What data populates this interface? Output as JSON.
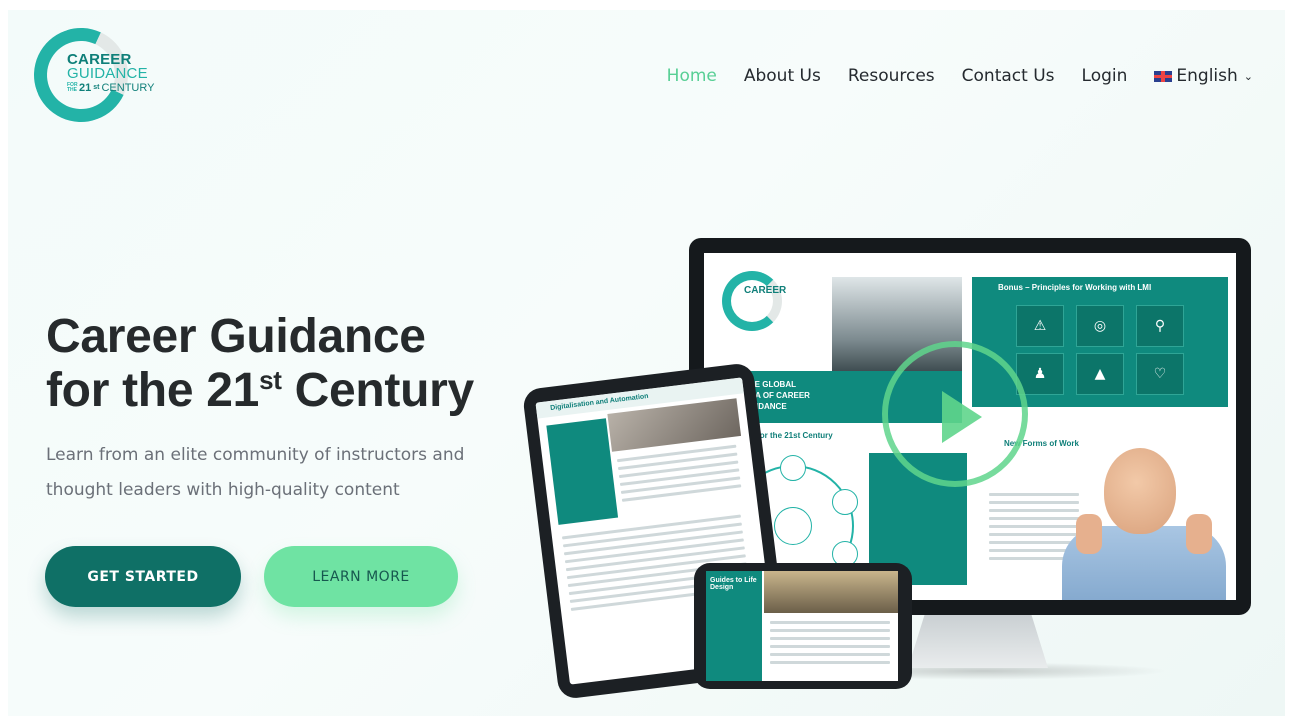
{
  "logo": {
    "line1": "CAREER",
    "line2": "GUIDANCE",
    "line3_prefix": "FOR THE",
    "line3_num": "21",
    "line3_sup": "st",
    "line3_word": "CENTURY"
  },
  "nav": {
    "items": [
      {
        "label": "Home",
        "active": true
      },
      {
        "label": "About Us",
        "active": false
      },
      {
        "label": "Resources",
        "active": false
      },
      {
        "label": "Contact Us",
        "active": false
      },
      {
        "label": "Login",
        "active": false
      }
    ],
    "language": "English"
  },
  "hero": {
    "title_line1": "Career Guidance",
    "title_line2_pre": "for the 21",
    "title_line2_sup": "st",
    "title_line2_post": " Century",
    "subtitle": "Learn from an elite community of instructors and thought leaders with high-quality content",
    "cta_primary": "GET STARTED",
    "cta_secondary": "LEARN MORE"
  },
  "mockup": {
    "screen_heading_skills": "Skills for the 21st Century",
    "screen_heading_bonus": "Bonus – Principles for Working with LMI",
    "screen_heading_work": "New Forms of Work",
    "screen_band": "THE GLOBAL ERA OF CAREER GUIDANCE",
    "tablet_heading": "Digitalisation and Automation",
    "phone_heading": "Guides to Life Design"
  },
  "colors": {
    "accent": "#58cf95",
    "brand_dark": "#0f7066",
    "brand_teal": "#23b3a7",
    "button_light": "#6fe3a3"
  }
}
